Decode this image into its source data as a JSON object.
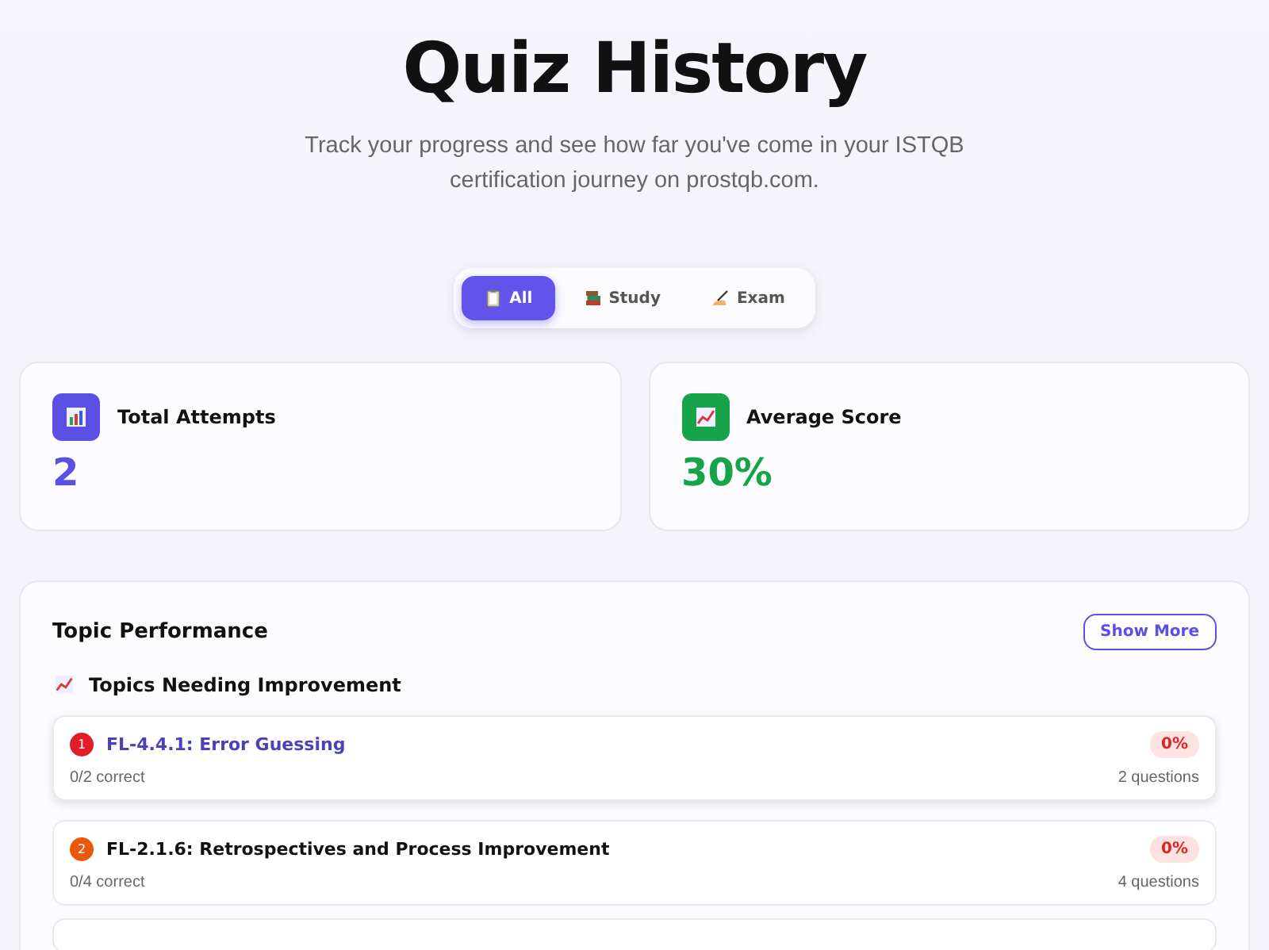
{
  "header": {
    "title": "Quiz History",
    "subtitle": "Track your progress and see how far you've come in your ISTQB certification journey on prostqb.com."
  },
  "tabs": [
    {
      "label": "All",
      "selected": true
    },
    {
      "label": "Study",
      "selected": false
    },
    {
      "label": "Exam",
      "selected": false
    }
  ],
  "stats": [
    {
      "label": "Total Attempts",
      "value": "2",
      "color": "#5b50e6"
    },
    {
      "label": "Average Score",
      "value": "30%",
      "color": "#16a34a"
    }
  ],
  "topic_performance": {
    "title": "Topic Performance",
    "button": "Show More",
    "section": "Topics Needing Improvement",
    "topics": [
      {
        "rank": "1",
        "title": "FL-4.4.1: Error Guessing",
        "correct": "0/2 correct",
        "score": "0%",
        "questions": "2 questions",
        "color": "#e11d2a",
        "highlighted": true
      },
      {
        "rank": "2",
        "title": "FL-2.1.6: Retrospectives and Process Improvement",
        "correct": "0/4 correct",
        "score": "0%",
        "questions": "4 questions",
        "color": "#ea580c",
        "highlighted": false
      }
    ]
  }
}
